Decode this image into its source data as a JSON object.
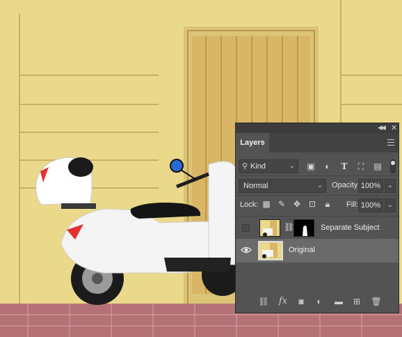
{
  "panel": {
    "title": "Layers",
    "filter": {
      "label": "Kind"
    },
    "blend_mode": "Normal",
    "opacity": {
      "label": "Opacity:",
      "value": "100%"
    },
    "lock_label": "Lock:",
    "fill": {
      "label": "Fill:",
      "value": "100%"
    },
    "layers": [
      {
        "name": "Separate Subject",
        "visible": false,
        "has_mask": true,
        "selected": false
      },
      {
        "name": "Original",
        "visible": true,
        "has_mask": false,
        "selected": true
      }
    ]
  },
  "colors": {
    "panel_bg": "#535353",
    "selected_row": "#6a6a6a",
    "wall": "#e9d889",
    "door": "#d9b866",
    "pavement": "#b06a6e"
  }
}
